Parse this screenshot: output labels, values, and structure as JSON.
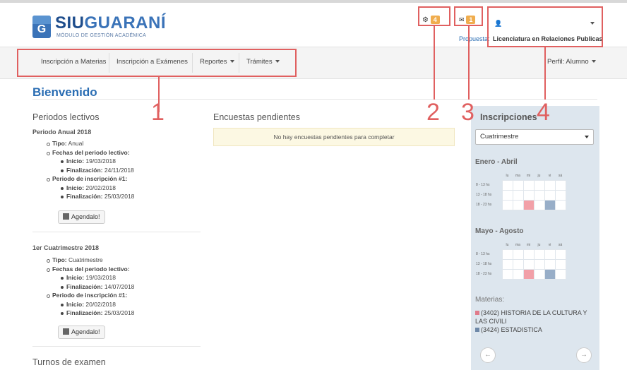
{
  "header": {
    "brand_prefix": "SIU",
    "brand_hl": "GUARANÍ",
    "brand_sub": "MÓDULO DE GESTIÓN ACADÉMICA",
    "logo_letter": "G",
    "notif_count": "4",
    "msg_count": "1",
    "propuesta_label": "Propuesta:",
    "propuesta_value": "Licenciatura en Relaciones Publicas"
  },
  "nav": {
    "items": [
      "Inscripción a Materias",
      "Inscripción a Exámenes",
      "Reportes",
      "Trámites"
    ],
    "perfil": "Perfil: Alumno"
  },
  "annotations": [
    "1",
    "2",
    "3",
    "4"
  ],
  "main": {
    "title": "Bienvenido",
    "periodos_title": "Periodos lectivos",
    "periodo1": {
      "name": "Periodo Anual 2018",
      "tipo_label": "Tipo:",
      "tipo": "Anual",
      "fechas_label": "Fechas del periodo lectivo:",
      "inicio_label": "Inicio:",
      "inicio": "19/03/2018",
      "fin_label": "Finalización:",
      "fin": "24/11/2018",
      "insc_label": "Periodo de inscripción #1:",
      "insc_inicio": "20/02/2018",
      "insc_fin": "25/03/2018",
      "button": "Agendalo!"
    },
    "periodo2": {
      "name": "1er Cuatrimestre 2018",
      "tipo_label": "Tipo:",
      "tipo": "Cuatrimestre",
      "fechas_label": "Fechas del periodo lectivo:",
      "inicio_label": "Inicio:",
      "inicio": "19/03/2018",
      "fin_label": "Finalización:",
      "fin": "14/07/2018",
      "insc_label": "Periodo de inscripción #1:",
      "insc_inicio": "20/02/2018",
      "insc_fin": "25/03/2018",
      "button": "Agendalo!"
    },
    "turnos_title": "Turnos de examen",
    "encuestas_title": "Encuestas pendientes",
    "encuestas_msg": "No hay encuestas pendientes para completar"
  },
  "inscripciones": {
    "title": "Inscripciones",
    "select": "Cuatrimestre",
    "sec1": "Enero - Abril",
    "sec2": "Mayo - Agosto",
    "days": [
      "lu",
      "ma",
      "mi",
      "ju",
      "vi",
      "sá"
    ],
    "slots": [
      "8 - 13 hs",
      "13 - 18 hs",
      "18 - 23 hs"
    ],
    "materias_label": "Materias:",
    "materias": [
      "(3402) HISTORIA DE LA CULTURA Y LAS CIVILI",
      "(3424) ESTADISTICA"
    ],
    "prev": "←",
    "next": "→"
  },
  "colors": {
    "accent": "#2a6db3",
    "annotation": "#e06060",
    "badge": "#f0ad4e",
    "pink": "#f2a0a8",
    "blue": "#98aec8"
  }
}
